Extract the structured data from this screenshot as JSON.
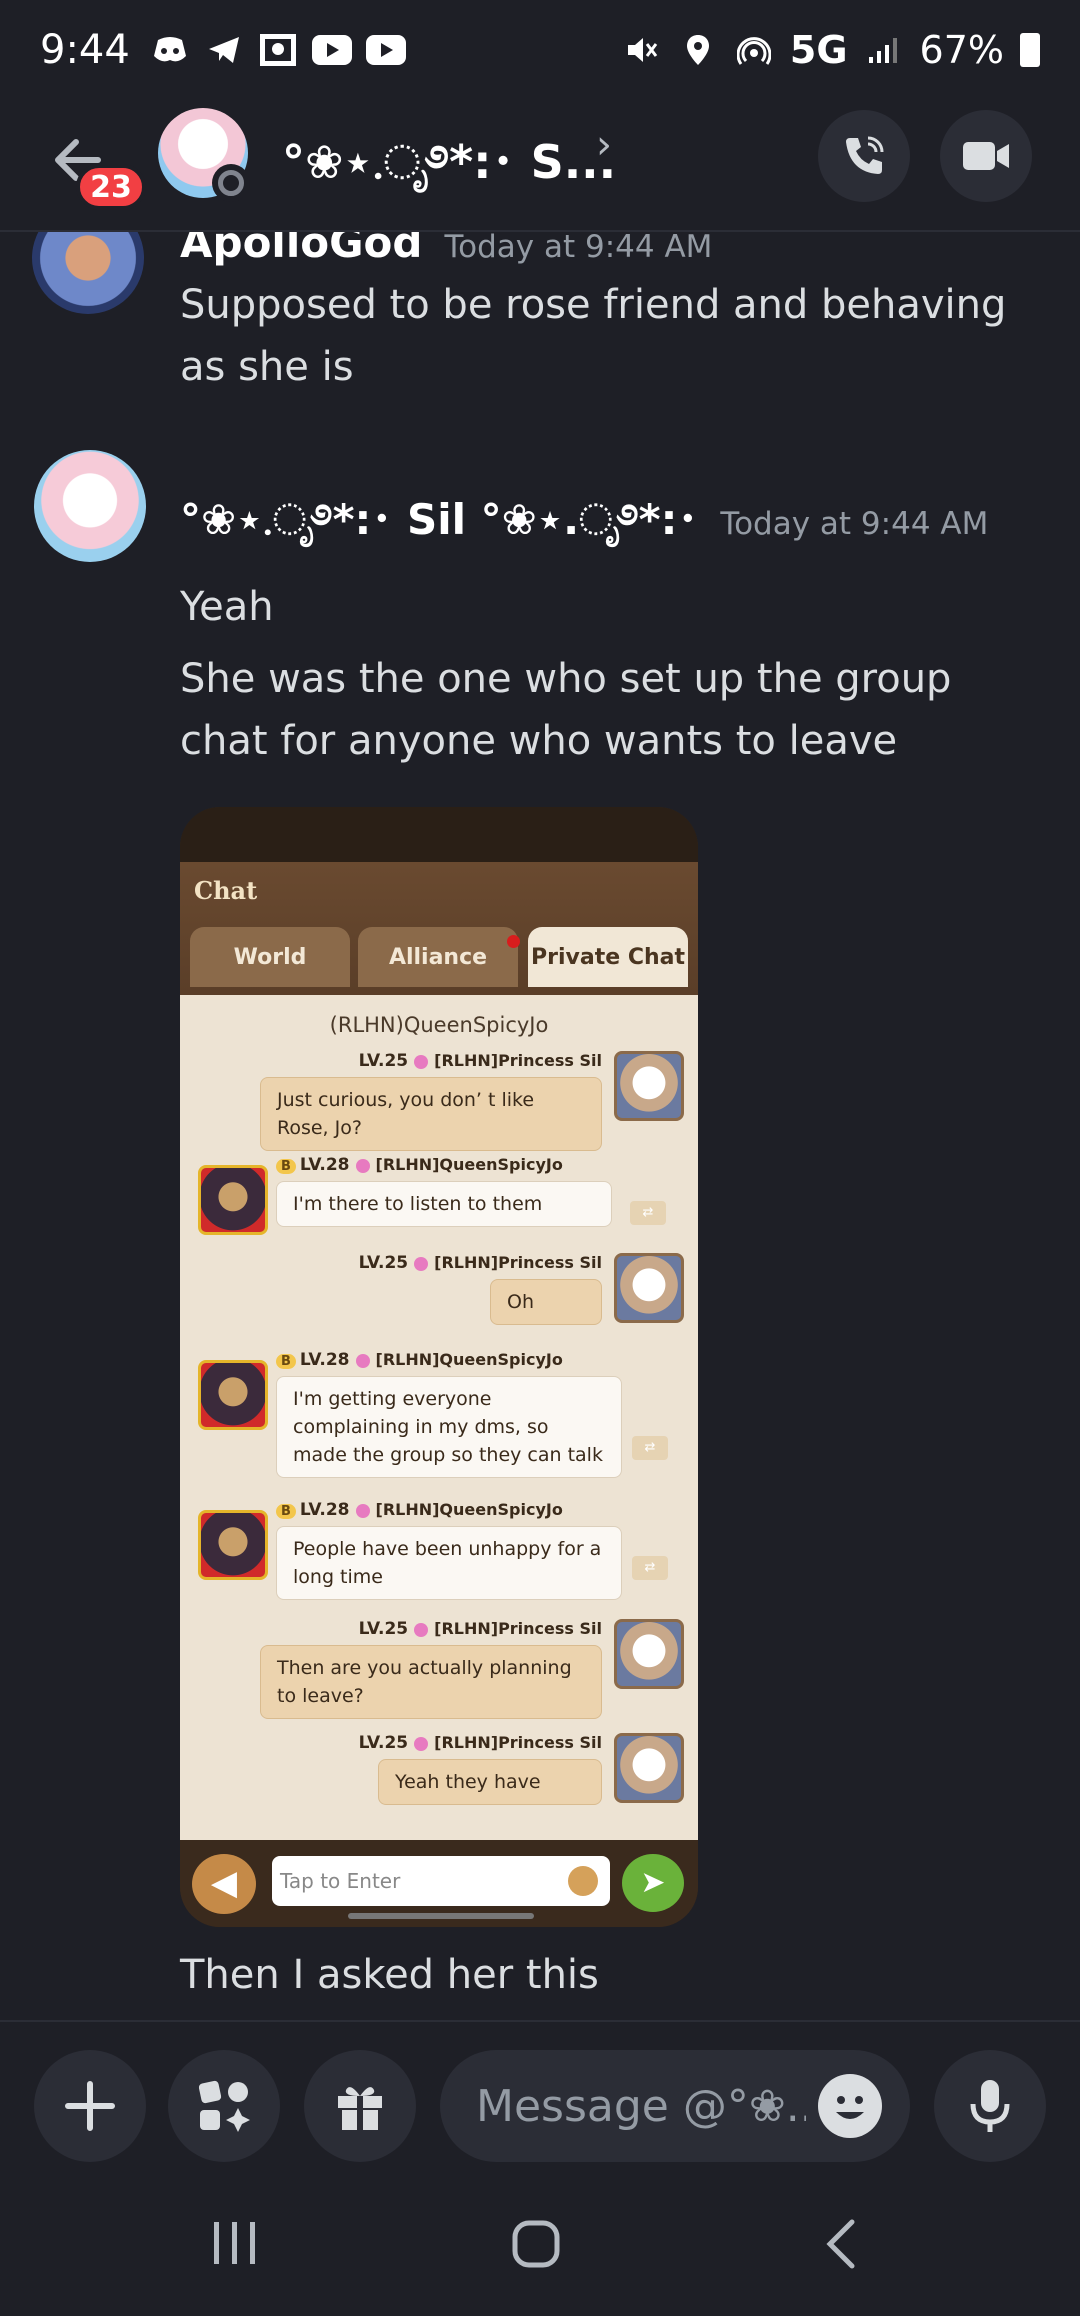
{
  "status_bar": {
    "time": "9:44",
    "network": "5G",
    "battery": "67%"
  },
  "header": {
    "unread_badge": "23",
    "channel_name": "°❀⋆.ೃ࿔*:･ S...",
    "chevron": "›"
  },
  "messages": [
    {
      "author": "ApolloGod",
      "timestamp": "Today at 9:44 AM",
      "lines": [
        "Supposed to be rose friend and behaving as she is"
      ]
    },
    {
      "author": "°❀⋆.ೃ࿔*:･ Sil °❀⋆.ೃ࿔*:･",
      "timestamp": "Today at 9:44 AM",
      "lines": [
        "Yeah",
        "She was the one who set up the group chat for anyone who wants to leave"
      ],
      "after_image": "Then I asked her this"
    }
  ],
  "attachment": {
    "title": "Chat",
    "tabs": [
      "World",
      "Alliance",
      "Private Chat"
    ],
    "active_tab": "Private Chat",
    "peer": "(RLHN)QueenSpicyJo",
    "input_placeholder": "Tap to Enter",
    "chat": [
      {
        "from": "me",
        "level": "LV.25",
        "name": "[RLHN]Princess Sil",
        "text": "Just curious, you don’ t like Rose, Jo?"
      },
      {
        "from": "them",
        "vip": "B",
        "level": "LV.28",
        "name": "[RLHN]QueenSpicyJo",
        "text": "I'm there to listen to them"
      },
      {
        "from": "me",
        "level": "LV.25",
        "name": "[RLHN]Princess Sil",
        "text": "Oh"
      },
      {
        "from": "them",
        "vip": "B",
        "level": "LV.28",
        "name": "[RLHN]QueenSpicyJo",
        "text": "I'm getting everyone complaining in my dms, so made the group so they can talk"
      },
      {
        "from": "them",
        "vip": "B",
        "level": "LV.28",
        "name": "[RLHN]QueenSpicyJo",
        "text": "People have been unhappy for a long time"
      },
      {
        "from": "me",
        "level": "LV.25",
        "name": "[RLHN]Princess Sil",
        "text": "Then are you actually planning to leave?"
      },
      {
        "from": "me",
        "level": "LV.25",
        "name": "[RLHN]Princess Sil",
        "text": "Yeah they have"
      }
    ]
  },
  "composer": {
    "placeholder": "Message @°❀..."
  },
  "colors": {
    "background": "#1e1f26",
    "badge": "#f23f43",
    "surface": "#2b2d36"
  }
}
